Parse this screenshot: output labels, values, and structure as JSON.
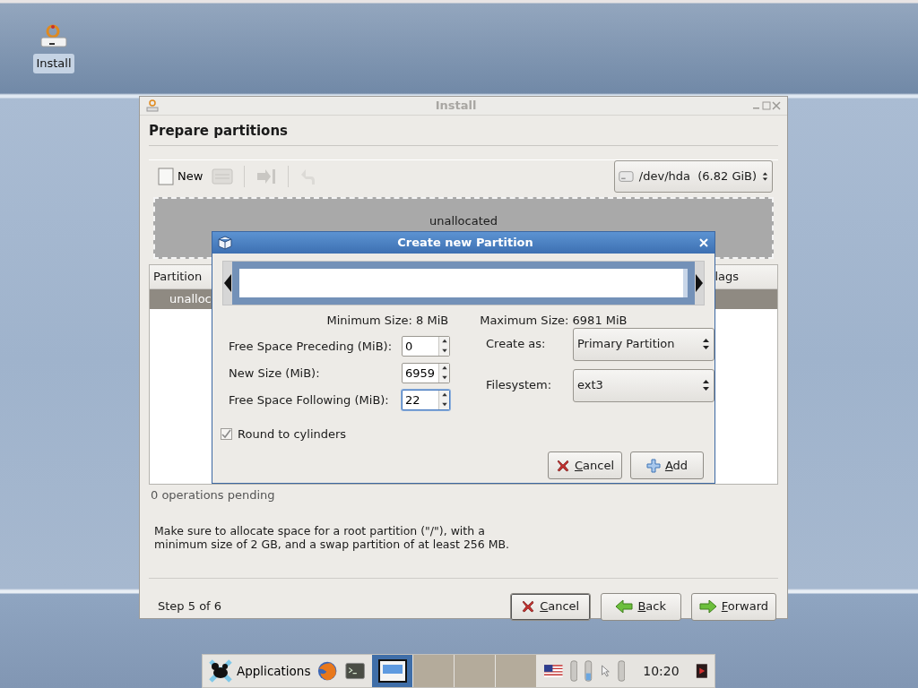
{
  "desktop_icons": [
    {
      "label": "Install"
    }
  ],
  "window": {
    "title": "Install",
    "heading": "Prepare partitions",
    "toolbar": {
      "new_label": "New",
      "disk": "/dev/hda  (6.82 GiB)"
    },
    "partition_bar": {
      "label": "unallocated"
    },
    "table": {
      "columns": [
        "Partition",
        "lags"
      ],
      "rows": [
        {
          "cells": [
            "unalloc"
          ],
          "selected": true
        }
      ]
    },
    "operations": "0 operations pending",
    "hint": "Make sure to allocate space for a root partition (\"/\"), with a\nminimum size of 2 GB, and a swap partition of at least 256 MB.",
    "step": "Step 5 of 6",
    "buttons": [
      {
        "kind": "cancel",
        "label": "Cancel"
      },
      {
        "kind": "back",
        "label": "Back"
      },
      {
        "kind": "forward",
        "label": "Forward"
      }
    ]
  },
  "dialog": {
    "title": "Create new Partition",
    "slider": {
      "level": 0.99
    },
    "min_size": "Minimum Size: 8 MiB",
    "max_size": "Maximum Size: 6981 MiB",
    "fields": [
      {
        "label": "Free Space Preceding (MiB):",
        "value": "0",
        "focused": false
      },
      {
        "label": "New Size (MiB):",
        "value": "6959",
        "focused": false
      },
      {
        "label": "Free Space Following (MiB):",
        "value": "22",
        "focused": true
      }
    ],
    "selects": [
      {
        "label": "Create as:",
        "value": "Primary Partition"
      },
      {
        "label": "Filesystem:",
        "value": "ext3"
      }
    ],
    "round": {
      "label": "Round to cylinders",
      "checked": true
    },
    "buttons": [
      {
        "kind": "cancel",
        "label": "Cancel"
      },
      {
        "kind": "add",
        "label": "Add"
      }
    ]
  },
  "taskbar": {
    "menu_label": "Applications",
    "workspaces": [
      {
        "selected": true
      },
      {
        "selected": false
      },
      {
        "selected": false
      },
      {
        "selected": false
      }
    ],
    "clock": "10:20"
  }
}
